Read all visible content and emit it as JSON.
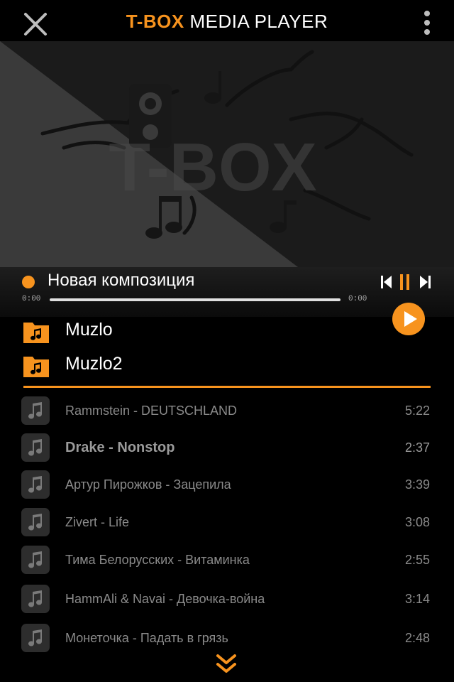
{
  "header": {
    "brand": "T-BOX",
    "subtitle": "MEDIA PLAYER",
    "close_icon": "close-icon",
    "menu_icon": "more-vertical-icon"
  },
  "cover": {
    "logo_text": "T-BOX"
  },
  "now_playing": {
    "title": "Новая композиция",
    "time_current": "0:00",
    "time_total": "0:00",
    "progress": 0
  },
  "folders": [
    {
      "name": "Muzlo"
    },
    {
      "name": "Muzlo2"
    }
  ],
  "tracks": [
    {
      "title": "Rammstein - DEUTSCHLAND",
      "duration": "5:22"
    },
    {
      "title": "Drake - Nonstop",
      "duration": "2:37"
    },
    {
      "title": "Артур Пирожков - Зацепила",
      "duration": "3:39"
    },
    {
      "title": "Zivert - Life",
      "duration": "3:08"
    },
    {
      "title": "Тима Белорусских - Витаминка",
      "duration": "2:55"
    },
    {
      "title": "HammAli & Navai - Девочка-война",
      "duration": "3:14"
    },
    {
      "title": "Монеточка - Падать в грязь",
      "duration": "2:48"
    }
  ],
  "colors": {
    "accent": "#f7931e",
    "background": "#000000",
    "track_text": "#8a8a8a"
  }
}
